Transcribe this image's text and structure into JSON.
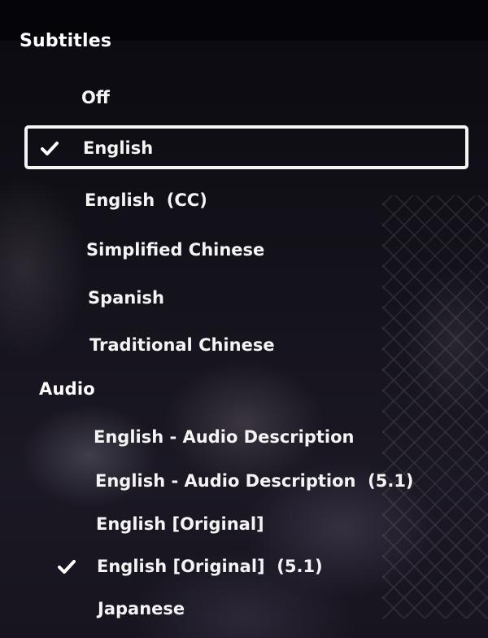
{
  "subtitles": {
    "heading": "Subtitles",
    "options": [
      {
        "label": "Off",
        "selected": false
      },
      {
        "label": "English",
        "selected": true
      },
      {
        "label": "English  (CC)",
        "selected": false
      },
      {
        "label": "Simplified Chinese",
        "selected": false
      },
      {
        "label": "Spanish",
        "selected": false
      },
      {
        "label": "Traditional Chinese",
        "selected": false
      }
    ]
  },
  "audio": {
    "heading": "Audio",
    "options": [
      {
        "label": "English - Audio Description",
        "selected": false
      },
      {
        "label": "English - Audio Description  (5.1)",
        "selected": false
      },
      {
        "label": "English [Original]",
        "selected": false
      },
      {
        "label": "English [Original]  (5.1)",
        "selected": true
      },
      {
        "label": "Japanese",
        "selected": false
      }
    ]
  },
  "icons": {
    "checkmark": "checkmark-icon"
  },
  "colors": {
    "text": "#f4f4f4",
    "focus_border": "#f5f5f5",
    "background": "#0c0b12"
  }
}
